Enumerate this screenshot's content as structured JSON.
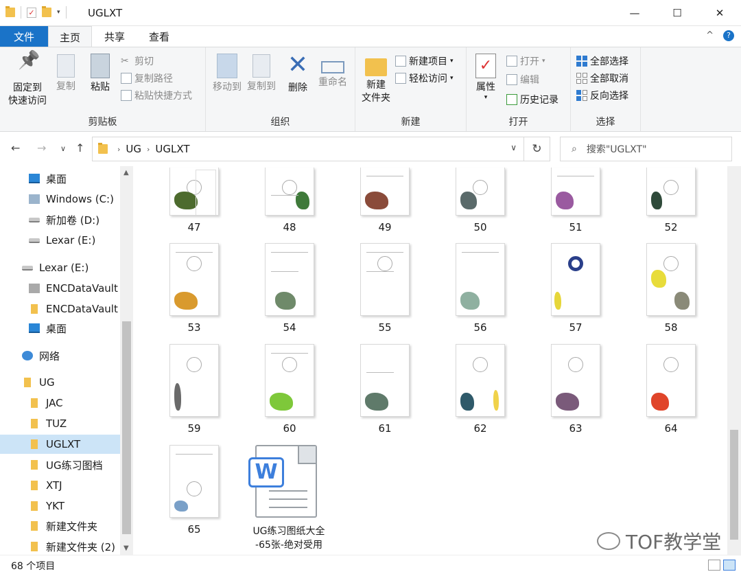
{
  "window": {
    "title": "UGLXT",
    "minimize": "—",
    "maximize": "☐",
    "close": "✕"
  },
  "ribbon_tabs": {
    "file": "文件",
    "home": "主页",
    "share": "共享",
    "view": "查看",
    "collapse": "^",
    "help": "?"
  },
  "ribbon": {
    "clipboard": {
      "label": "剪贴板",
      "pin": "固定到\n快速访问",
      "copy": "复制",
      "paste": "粘贴",
      "cut": "剪切",
      "copy_path": "复制路径",
      "paste_shortcut": "粘贴快捷方式"
    },
    "organize": {
      "label": "组织",
      "move_to": "移动到",
      "copy_to": "复制到",
      "delete": "删除",
      "rename": "重命名"
    },
    "new": {
      "label": "新建",
      "new_folder": "新建\n文件夹",
      "new_item": "新建项目",
      "easy_access": "轻松访问"
    },
    "open": {
      "label": "打开",
      "properties": "属性",
      "open": "打开",
      "edit": "编辑",
      "history": "历史记录"
    },
    "select": {
      "label": "选择",
      "select_all": "全部选择",
      "select_none": "全部取消",
      "invert": "反向选择"
    }
  },
  "address": {
    "crumbs": [
      "UG",
      "UGLXT"
    ],
    "search_placeholder": "搜索\"UGLXT\""
  },
  "sidebar": {
    "items": [
      {
        "label": "桌面",
        "icon": "desktop-icon"
      },
      {
        "label": "Windows (C:)",
        "icon": "windows-drive-icon"
      },
      {
        "label": "新加卷 (D:)",
        "icon": "drive-icon"
      },
      {
        "label": "Lexar (E:)",
        "icon": "drive-icon"
      },
      {
        "label": "Lexar (E:)",
        "icon": "drive-icon"
      },
      {
        "label": "ENCDataVault",
        "icon": "vault-icon"
      },
      {
        "label": "ENCDataVault S",
        "icon": "folder-icon"
      },
      {
        "label": "桌面",
        "icon": "desktop-icon"
      },
      {
        "label": "网络",
        "icon": "network-icon"
      },
      {
        "label": "UG",
        "icon": "folder-icon"
      },
      {
        "label": "JAC",
        "icon": "folder-icon"
      },
      {
        "label": "TUZ",
        "icon": "folder-icon"
      },
      {
        "label": "UGLXT",
        "icon": "folder-icon",
        "selected": true
      },
      {
        "label": "UG练习图档",
        "icon": "folder-icon"
      },
      {
        "label": "XTJ",
        "icon": "folder-icon"
      },
      {
        "label": "YKT",
        "icon": "folder-icon"
      },
      {
        "label": "新建文件夹",
        "icon": "folder-icon"
      },
      {
        "label": "新建文件夹 (2)",
        "icon": "folder-icon"
      }
    ]
  },
  "files": {
    "images": [
      "47",
      "48",
      "49",
      "50",
      "51",
      "52",
      "53",
      "54",
      "55",
      "56",
      "57",
      "58",
      "59",
      "60",
      "61",
      "62",
      "63",
      "64",
      "65"
    ],
    "word_doc_line1": "UG练习图纸大全",
    "word_doc_line2": "-65张-绝对受用",
    "word_badge": "W"
  },
  "status": {
    "item_count": "68 个项目"
  },
  "watermark": "TOF教学堂",
  "colors": {
    "accent": "#1a73c8",
    "selection": "#cce4f7",
    "folder": "#f2c14e"
  }
}
